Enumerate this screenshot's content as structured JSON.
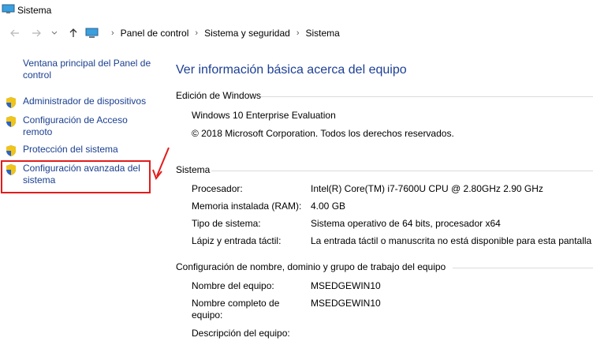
{
  "window": {
    "title": "Sistema"
  },
  "breadcrumb": [
    "Panel de control",
    "Sistema y seguridad",
    "Sistema"
  ],
  "sidebar": {
    "home_link": "Ventana principal del Panel de control",
    "items": [
      {
        "label": "Administrador de dispositivos",
        "icon": "shield-icon"
      },
      {
        "label": "Configuración de Acceso remoto",
        "icon": "shield-icon"
      },
      {
        "label": "Protección del sistema",
        "icon": "shield-icon"
      },
      {
        "label": "Configuración avanzada del sistema",
        "icon": "shield-icon"
      }
    ]
  },
  "main": {
    "title": "Ver información básica acerca del equipo",
    "edition": {
      "header": "Edición de Windows",
      "name": "Windows 10 Enterprise Evaluation",
      "copyright": "© 2018 Microsoft Corporation. Todos los derechos reservados."
    },
    "system": {
      "header": "Sistema",
      "rows": [
        {
          "key": "Procesador:",
          "value": "Intel(R) Core(TM) i7-7600U CPU @ 2.80GHz   2.90 GHz"
        },
        {
          "key": "Memoria instalada (RAM):",
          "value": "4.00 GB"
        },
        {
          "key": "Tipo de sistema:",
          "value": "Sistema operativo de 64 bits, procesador x64"
        },
        {
          "key": "Lápiz y entrada táctil:",
          "value": "La entrada táctil o manuscrita no está disponible para esta pantalla"
        }
      ]
    },
    "computer": {
      "header": "Configuración de nombre, dominio y grupo de trabajo del equipo",
      "rows": [
        {
          "key": "Nombre del equipo:",
          "value": "MSEDGEWIN10"
        },
        {
          "key": "Nombre completo de equipo:",
          "value": "MSEDGEWIN10"
        },
        {
          "key": "Descripción del equipo:",
          "value": ""
        }
      ]
    }
  },
  "colors": {
    "link": "#1a3f8f",
    "heading": "#1c3f94",
    "highlight": "#e31b1b"
  }
}
